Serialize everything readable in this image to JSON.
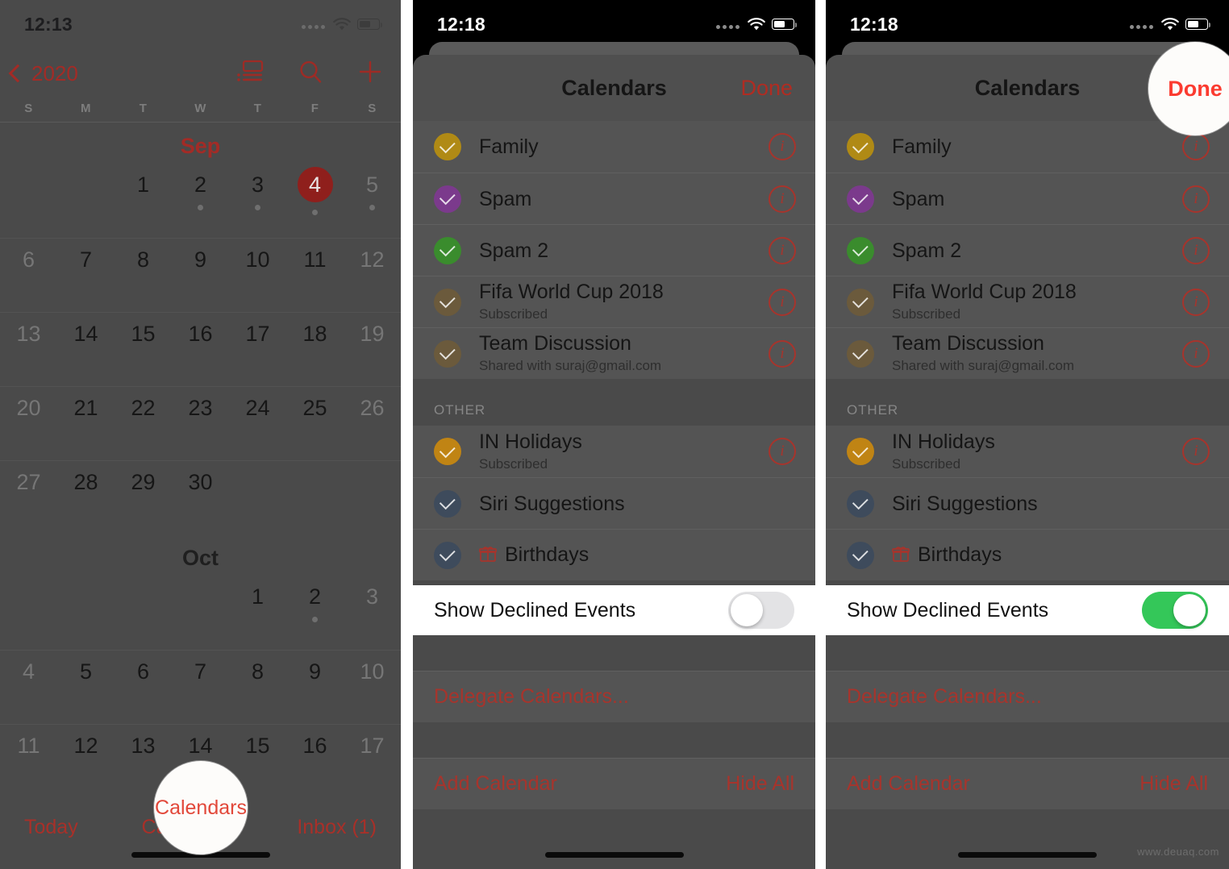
{
  "watermark": "www.deuaq.com",
  "colors": {
    "accent_red": "#a7342c",
    "highlight_red": "#e2483a",
    "toggle_on_green": "#34c759",
    "today_badge": "#8f1f1c"
  },
  "panel1": {
    "status": {
      "time": "12:13",
      "wifi_icon": "wifi-icon",
      "battery_icon": "battery-icon",
      "signal_icon": "signal-dots-icon"
    },
    "nav": {
      "back_label": "2020",
      "back_icon": "chevron-left-icon",
      "list_view_icon": "list-view-icon",
      "search_icon": "search-icon",
      "add_icon": "plus-icon"
    },
    "weekdays": [
      "S",
      "M",
      "T",
      "W",
      "T",
      "F",
      "S"
    ],
    "months": [
      {
        "name": "Sep",
        "weeks": [
          [
            {
              "n": "",
              "blank": true
            },
            {
              "n": "",
              "blank": true
            },
            {
              "n": "1"
            },
            {
              "n": "2",
              "dot": true
            },
            {
              "n": "3",
              "dot": true
            },
            {
              "n": "4",
              "today": true,
              "dot": true
            },
            {
              "n": "5",
              "weekend": true,
              "dot": true
            }
          ],
          [
            {
              "n": "6",
              "weekend": true
            },
            {
              "n": "7"
            },
            {
              "n": "8"
            },
            {
              "n": "9"
            },
            {
              "n": "10"
            },
            {
              "n": "11"
            },
            {
              "n": "12",
              "weekend": true
            }
          ],
          [
            {
              "n": "13",
              "weekend": true
            },
            {
              "n": "14"
            },
            {
              "n": "15"
            },
            {
              "n": "16"
            },
            {
              "n": "17"
            },
            {
              "n": "18"
            },
            {
              "n": "19",
              "weekend": true
            }
          ],
          [
            {
              "n": "20",
              "weekend": true
            },
            {
              "n": "21"
            },
            {
              "n": "22"
            },
            {
              "n": "23"
            },
            {
              "n": "24"
            },
            {
              "n": "25"
            },
            {
              "n": "26",
              "weekend": true
            }
          ],
          [
            {
              "n": "27",
              "weekend": true
            },
            {
              "n": "28"
            },
            {
              "n": "29"
            },
            {
              "n": "30"
            },
            {
              "n": "",
              "blank": true
            },
            {
              "n": "",
              "blank": true
            },
            {
              "n": "",
              "blank": true
            }
          ]
        ]
      },
      {
        "name": "Oct",
        "weeks": [
          [
            {
              "n": "",
              "blank": true
            },
            {
              "n": "",
              "blank": true
            },
            {
              "n": "",
              "blank": true
            },
            {
              "n": "",
              "blank": true
            },
            {
              "n": "1"
            },
            {
              "n": "2",
              "dot": true
            },
            {
              "n": "3",
              "weekend": true
            }
          ],
          [
            {
              "n": "4",
              "weekend": true
            },
            {
              "n": "5"
            },
            {
              "n": "6"
            },
            {
              "n": "7"
            },
            {
              "n": "8"
            },
            {
              "n": "9"
            },
            {
              "n": "10",
              "weekend": true
            }
          ],
          [
            {
              "n": "11",
              "weekend": true
            },
            {
              "n": "12"
            },
            {
              "n": "13"
            },
            {
              "n": "14"
            },
            {
              "n": "15"
            },
            {
              "n": "16"
            },
            {
              "n": "17",
              "weekend": true
            }
          ]
        ]
      }
    ],
    "tabbar": {
      "today": "Today",
      "calendars": "Calendars",
      "inbox": "Inbox (1)"
    },
    "highlight": {
      "label": "Calendars"
    }
  },
  "sheet": {
    "status": {
      "time": "12:18",
      "wifi_icon": "wifi-icon",
      "battery_icon": "battery-icon",
      "signal_icon": "signal-dots-icon"
    },
    "title": "Calendars",
    "done_label": "Done",
    "calendars": [
      {
        "name": "Family",
        "sub": "",
        "color": "#b08a15",
        "info_icon": "info-icon",
        "checked": true
      },
      {
        "name": "Spam",
        "sub": "",
        "color": "#7b3a8c",
        "info_icon": "info-icon",
        "checked": true
      },
      {
        "name": "Spam 2",
        "sub": "",
        "color": "#3a8c2d",
        "info_icon": "info-icon",
        "checked": true
      },
      {
        "name": "Fifa World Cup 2018",
        "sub": "Subscribed",
        "color": "#6b5a3c",
        "info_icon": "info-icon",
        "checked": true
      },
      {
        "name": "Team Discussion",
        "sub": "Shared with suraj@gmail.com",
        "color": "#6b5a3c",
        "info_icon": "info-icon",
        "checked": true
      }
    ],
    "other_section_label": "OTHER",
    "other": [
      {
        "name": "IN Holidays",
        "sub": "Subscribed",
        "color": "#c08414",
        "info_icon": "info-icon",
        "checked": true,
        "gift": false
      },
      {
        "name": "Siri Suggestions",
        "sub": "",
        "color": "#3e4b5c",
        "info_icon": "",
        "checked": true,
        "gift": false
      },
      {
        "name": "Birthdays",
        "sub": "",
        "color": "#3e4b5c",
        "info_icon": "",
        "checked": true,
        "gift": true,
        "gift_icon": "gift-icon"
      }
    ],
    "declined_label": "Show Declined Events",
    "delegate_label": "Delegate Calendars...",
    "add_calendar_label": "Add Calendar",
    "hide_all_label": "Hide All"
  },
  "panel2": {
    "declined_toggle_state": "off"
  },
  "panel3": {
    "declined_toggle_state": "on",
    "highlight": {
      "label": "Done"
    }
  }
}
